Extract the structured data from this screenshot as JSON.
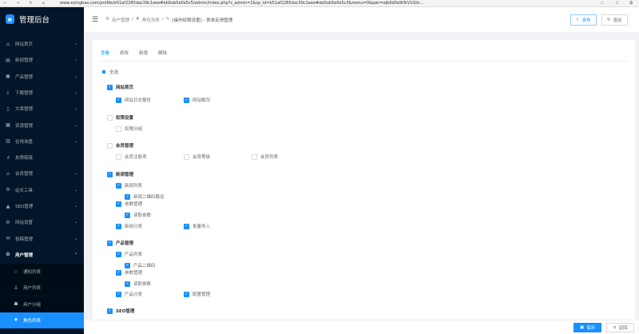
{
  "browser": {
    "url": "www.eyingbao.com/profile/e51af2285dac39c1eee#eb0ub5e0e5c5/admin/index.php?s_admin=1&sp_id=b51af2285dac39c1eee#eb0ub5e0e5c3&menu=0&pwr=ejb0d0a9OkV1Qilc..."
  },
  "sidebar": {
    "title": "管理后台",
    "items": [
      {
        "label": "网站首页",
        "icon": "home-icon",
        "glyph": "⌂",
        "chev": true
      },
      {
        "label": "新闻管理",
        "icon": "news-icon",
        "glyph": "▤",
        "chev": true
      },
      {
        "label": "产品管理",
        "icon": "image-icon",
        "glyph": "▣",
        "chev": true
      },
      {
        "label": "下载管理",
        "icon": "download-icon",
        "glyph": "⤓",
        "chev": true
      },
      {
        "label": "文章管理",
        "icon": "file-icon",
        "glyph": "▯",
        "chev": true
      },
      {
        "label": "资源管理",
        "icon": "grid-icon",
        "glyph": "▦",
        "chev": true
      },
      {
        "label": "在线询盘",
        "icon": "table-icon",
        "glyph": "▥",
        "chev": true
      },
      {
        "label": "友情链接",
        "icon": "link-icon",
        "glyph": "∂",
        "chev": false
      },
      {
        "label": "会员管理",
        "icon": "shop-icon",
        "glyph": "⌂",
        "chev": true
      },
      {
        "label": "站长工具",
        "icon": "tools-icon",
        "glyph": "⚙",
        "chev": true
      },
      {
        "label": "SEO管理",
        "icon": "warning-icon",
        "glyph": "▲",
        "chev": true
      },
      {
        "label": "网站设置",
        "icon": "settings-icon",
        "glyph": "⚙",
        "chev": true
      },
      {
        "label": "投稿管理",
        "icon": "mail-icon",
        "glyph": "✉",
        "chev": true
      },
      {
        "label": "用户管理",
        "icon": "gear-icon",
        "glyph": "⚙",
        "chev": true
      }
    ],
    "sub_items": [
      {
        "label": "通知列表",
        "icon": "star-icon",
        "glyph": "☆"
      },
      {
        "label": "用户列表",
        "icon": "user-icon",
        "glyph": "♙"
      },
      {
        "label": "用户分组",
        "icon": "group-icon",
        "glyph": "☗"
      },
      {
        "label": "角色列表",
        "icon": "role-icon",
        "glyph": "♦"
      }
    ]
  },
  "header": {
    "breadcrumb": [
      "用户管理",
      "角色列表",
      "[操作权限设置] - 表单反馈管理"
    ],
    "publish": "发布",
    "quit": "退出"
  },
  "tabs": [
    "查看",
    "修改",
    "新增",
    "删除"
  ],
  "select_all": "全选",
  "perms": [
    {
      "label": "网站首页",
      "level": 0,
      "checked": true
    },
    {
      "label": "网站日志报告",
      "level": 1,
      "col": 0,
      "checked": true
    },
    {
      "label": "网站概况",
      "level": 1,
      "col": 1,
      "checked": true
    },
    {
      "label": "权限设置",
      "level": 0,
      "checked": false
    },
    {
      "label": "权限分组",
      "level": 1,
      "col": 0,
      "checked": false
    },
    {
      "label": "会员管理",
      "level": 0,
      "checked": false
    },
    {
      "label": "会员注册项",
      "level": 1,
      "col": 0,
      "checked": false
    },
    {
      "label": "会员等级",
      "level": 1,
      "col": 1,
      "checked": false
    },
    {
      "label": "会员列表",
      "level": 1,
      "col": 2,
      "checked": false
    },
    {
      "label": "新闻管理",
      "level": 0,
      "checked": true
    },
    {
      "label": "新闻列表",
      "level": 1,
      "col": 0,
      "checked": true
    },
    {
      "label": "新闻二维码路径",
      "level": 2,
      "col": 0,
      "checked": true
    },
    {
      "label": "参数管理",
      "level": 1,
      "col": 0,
      "checked": true
    },
    {
      "label": "读取参数",
      "level": 2,
      "col": 0,
      "checked": true
    },
    {
      "label": "新闻分类",
      "level": 1,
      "col": 0,
      "checked": true
    },
    {
      "label": "批量导入",
      "level": 1,
      "col": 1,
      "checked": true
    },
    {
      "label": "产品管理",
      "level": 0,
      "checked": true
    },
    {
      "label": "产品列表",
      "level": 1,
      "col": 0,
      "checked": true
    },
    {
      "label": "产品二维码",
      "level": 2,
      "col": 0,
      "checked": true
    },
    {
      "label": "参数管理",
      "level": 1,
      "col": 0,
      "checked": true
    },
    {
      "label": "读取参数",
      "level": 2,
      "col": 0,
      "checked": true
    },
    {
      "label": "产品分类",
      "level": 1,
      "col": 0,
      "checked": true
    },
    {
      "label": "配置管理",
      "level": 1,
      "col": 1,
      "checked": true
    },
    {
      "label": "SEO管理",
      "level": 0,
      "checked": true
    }
  ],
  "footer": {
    "save": "保存",
    "back": "返回"
  },
  "colors": {
    "accent": "#1890ff",
    "sidebar": "#031529"
  }
}
